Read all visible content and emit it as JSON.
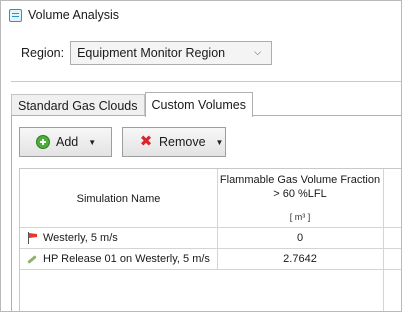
{
  "window": {
    "title": "Volume Analysis",
    "icon": "table-window-icon"
  },
  "region": {
    "label": "Region:",
    "value": "Equipment Monitor Region"
  },
  "tabs": [
    {
      "label": "Standard Gas Clouds",
      "active": false
    },
    {
      "label": "Custom Volumes",
      "active": true
    }
  ],
  "toolbar": {
    "add_label": "Add",
    "remove_label": "Remove"
  },
  "table": {
    "headers": {
      "name": "Simulation Name",
      "value": "Flammable Gas Volume Fraction > 60 %LFL",
      "unit": "[ m³ ]"
    },
    "rows": [
      {
        "name": "Westerly, 5 m/s",
        "value": "0",
        "icon": "windsock-icon"
      },
      {
        "name": "HP Release 01 on Westerly, 5 m/s",
        "value": "2.7642",
        "icon": "release-icon"
      }
    ]
  },
  "colors": {
    "accent": "#2f8fd1",
    "add_green": "#4caf3a",
    "remove_red": "#d9262b"
  }
}
